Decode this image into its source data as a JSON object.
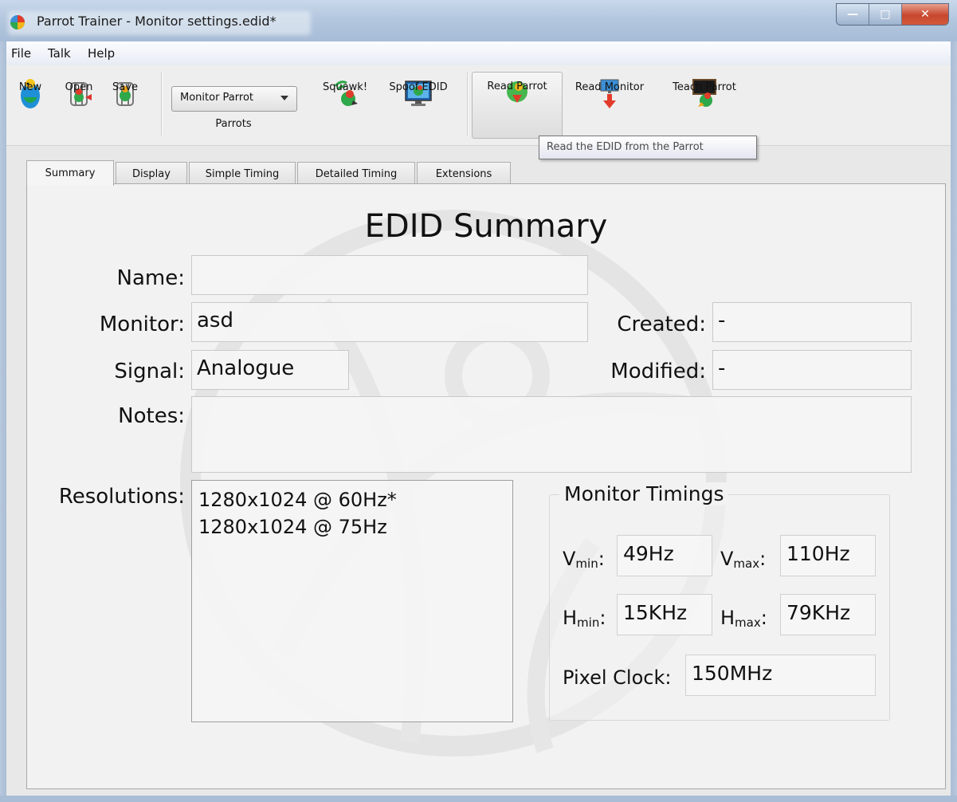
{
  "window": {
    "title": "Parrot Trainer - Monitor settings.edid*"
  },
  "menu": {
    "file": "File",
    "talk": "Talk",
    "help": "Help"
  },
  "toolbar": {
    "new": "New",
    "open": "Open",
    "save": "Save",
    "parrot_select": "Monitor Parrot",
    "parrots_label": "Parrots",
    "squawk": "Squawk!",
    "spoof_edid": "Spoof EDID",
    "read_parrot": "Read Parrot",
    "read_monitor": "Read Monitor",
    "teach_parrot": "Teach Parrot",
    "tooltip": "Read the EDID from the Parrot"
  },
  "tabs": [
    "Summary",
    "Display",
    "Simple Timing",
    "Detailed Timing",
    "Extensions"
  ],
  "summary": {
    "heading": "EDID Summary",
    "name_label": "Name:",
    "name_value": "",
    "monitor_label": "Monitor:",
    "monitor_value": "asd",
    "signal_label": "Signal:",
    "signal_value": "Analogue",
    "created_label": "Created:",
    "created_value": "-",
    "modified_label": "Modified:",
    "modified_value": "-",
    "notes_label": "Notes:",
    "notes_value": "",
    "resolutions_label": "Resolutions:",
    "resolutions": [
      "1280x1024 @ 60Hz*",
      "1280x1024 @ 75Hz"
    ]
  },
  "timings": {
    "title": "Monitor Timings",
    "vmin_main": "V",
    "vmin_sub": "min",
    "vmin_value": "49Hz",
    "vmax_main": "V",
    "vmax_sub": "max",
    "vmax_value": "110Hz",
    "hmin_main": "H",
    "hmin_sub": "min",
    "hmin_value": "15KHz",
    "hmax_main": "H",
    "hmax_sub": "max",
    "hmax_value": "79KHz",
    "pixel_clock_label": "Pixel Clock:",
    "pixel_clock_value": "150MHz"
  },
  "colors": {
    "accent": "#3b8fd6",
    "close": "#c7472d",
    "panel": "#f2f2f2"
  }
}
